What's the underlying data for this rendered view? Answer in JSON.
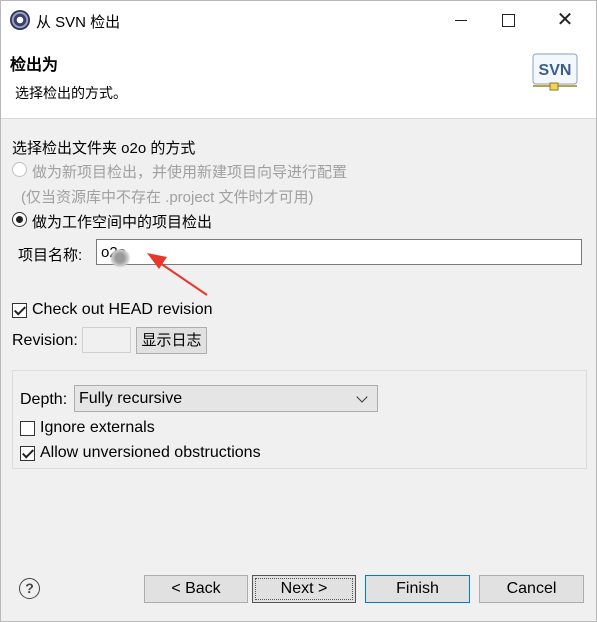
{
  "window": {
    "title": "从 SVN 检出",
    "close_glyph": "✕"
  },
  "banner": {
    "title": "检出为",
    "description": "选择检出的方式。",
    "logo_text": "SVN"
  },
  "checkout": {
    "section_label": "选择检出文件夹 o2o 的方式",
    "option_new_project": {
      "label": "做为新项目检出，并使用新建项目向导进行配置",
      "note": "(仅当资源库中不存在 .project 文件时才可用)",
      "selected": false,
      "enabled": false
    },
    "option_workspace": {
      "label": "做为工作空间中的项目检出",
      "selected": true
    },
    "project_name": {
      "label": "项目名称:",
      "value": "o2o"
    }
  },
  "revision": {
    "head_checkbox_label": "Check out HEAD revision",
    "head_checked": true,
    "revision_label": "Revision:",
    "revision_value": "",
    "show_log_label": "显示日志"
  },
  "options": {
    "depth_label": "Depth:",
    "depth_value": "Fully recursive",
    "ignore_externals_label": "Ignore externals",
    "ignore_externals_checked": false,
    "allow_unversioned_label": "Allow unversioned obstructions",
    "allow_unversioned_checked": true
  },
  "footer": {
    "help_glyph": "?",
    "back_label": "< Back",
    "next_label": "Next >",
    "finish_label": "Finish",
    "cancel_label": "Cancel"
  },
  "colors": {
    "annotation_arrow": "#e8372c",
    "finish_border": "#0078d7"
  },
  "icons": [
    "app-icon",
    "minimize-icon",
    "maximize-icon",
    "close-icon",
    "svn-logo",
    "chevron-down-icon",
    "help-icon",
    "annotation-arrow"
  ]
}
